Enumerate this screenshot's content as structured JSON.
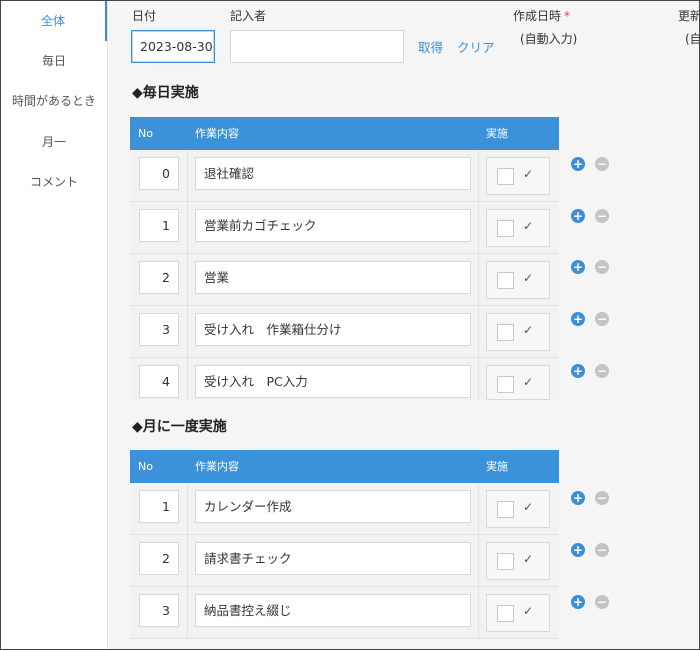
{
  "sidebar": {
    "items": [
      {
        "label": "全体",
        "active": true
      },
      {
        "label": "毎日",
        "active": false
      },
      {
        "label": "時間があるとき",
        "active": false
      },
      {
        "label": "月一",
        "active": false
      },
      {
        "label": "コメント",
        "active": false
      }
    ]
  },
  "form": {
    "date_label": "日付",
    "date_value": "2023-08-30",
    "recorder_label": "記入者",
    "recorder_value": "",
    "fetch_link": "取得",
    "clear_link": "クリア",
    "created_label": "作成日時",
    "created_required": "*",
    "created_value": "(自動入力)",
    "updated_label": "更新",
    "updated_value": "(自"
  },
  "sections": {
    "daily": {
      "title": "◆毎日実施",
      "headers": {
        "no": "No",
        "task": "作業内容",
        "done": "実施"
      },
      "rows": [
        {
          "no": "0",
          "task": "退社確認",
          "check": "✓"
        },
        {
          "no": "1",
          "task": "営業前カゴチェック",
          "check": "✓"
        },
        {
          "no": "2",
          "task": "営業",
          "check": "✓"
        },
        {
          "no": "3",
          "task": "受け入れ　作業箱仕分け",
          "check": "✓"
        },
        {
          "no": "4",
          "task": "受け入れ　PC入力",
          "check": "✓"
        }
      ]
    },
    "monthly": {
      "title": "◆月に一度実施",
      "headers": {
        "no": "No",
        "task": "作業内容",
        "done": "実施"
      },
      "rows": [
        {
          "no": "1",
          "task": "カレンダー作成",
          "check": "✓"
        },
        {
          "no": "2",
          "task": "請求書チェック",
          "check": "✓"
        },
        {
          "no": "3",
          "task": "納品書控え綴じ",
          "check": "✓"
        }
      ]
    }
  },
  "buttons": {
    "add": "+",
    "remove": "−"
  },
  "colors": {
    "accent": "#3b8fd9",
    "header": "#3b92d9",
    "required": "#e0413c"
  }
}
